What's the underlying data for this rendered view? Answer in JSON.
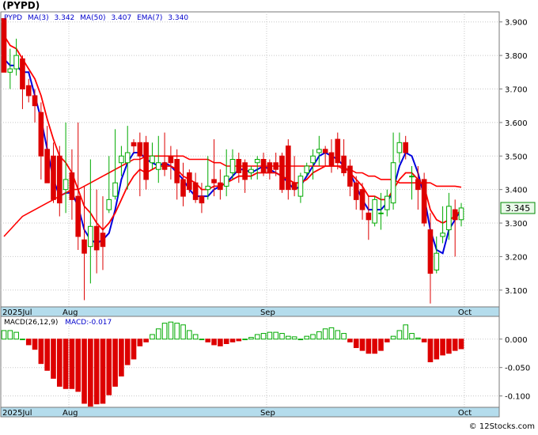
{
  "ticker_label": "(PYPD)",
  "legend": {
    "symbol": "PYPD",
    "ma3_label": "MA(3)",
    "ma3_value": "3.342",
    "ma50_label": "MA(50)",
    "ma50_value": "3.407",
    "ema7_label": "EMA(7)",
    "ema7_value": "3.340"
  },
  "last_price_badge": "3.345",
  "macd_legend": {
    "label": "MACD(26,12,9)",
    "value_label": "MACD:-0.017"
  },
  "watermark": "© 12Stocks.com",
  "colors": {
    "up_candle": "#00aa00",
    "down_candle": "#dd0000",
    "ma_red": "#ff0000",
    "ma_blue": "#0000dd",
    "month_band": "#b4dcec",
    "grid": "#c8c8c8",
    "badge_bg": "#e9fae9",
    "badge_border": "#008800"
  },
  "chart_data": [
    {
      "type": "candlestick",
      "title": "(PYPD)",
      "ylim": [
        3.05,
        3.93
      ],
      "y_ticks": [
        "3.100",
        "3.200",
        "3.300",
        "3.400",
        "3.500",
        "3.600",
        "3.700",
        "3.800",
        "3.900"
      ],
      "x_month_labels": [
        "2025Jul",
        "Aug",
        "Sep",
        "Oct"
      ],
      "x_month_label_index": [
        0,
        11,
        43,
        75
      ],
      "grid": true,
      "ohlc": [
        [
          3.91,
          3.91,
          3.75,
          3.75
        ],
        [
          3.75,
          3.82,
          3.7,
          3.76
        ],
        [
          3.76,
          3.85,
          3.74,
          3.8
        ],
        [
          3.79,
          3.8,
          3.64,
          3.7
        ],
        [
          3.71,
          3.73,
          3.66,
          3.68
        ],
        [
          3.68,
          3.7,
          3.6,
          3.65
        ],
        [
          3.63,
          3.66,
          3.43,
          3.5
        ],
        [
          3.52,
          3.59,
          3.42,
          3.42
        ],
        [
          3.5,
          3.54,
          3.36,
          3.37
        ],
        [
          3.5,
          3.53,
          3.32,
          3.36
        ],
        [
          3.4,
          3.6,
          3.33,
          3.43
        ],
        [
          3.45,
          3.52,
          3.31,
          3.37
        ],
        [
          3.38,
          3.6,
          3.22,
          3.26
        ],
        [
          3.25,
          3.41,
          3.07,
          3.21
        ],
        [
          3.23,
          3.49,
          3.12,
          3.29
        ],
        [
          3.29,
          3.4,
          3.15,
          3.22
        ],
        [
          3.27,
          3.38,
          3.16,
          3.23
        ],
        [
          3.34,
          3.5,
          3.33,
          3.37
        ],
        [
          3.38,
          3.58,
          3.37,
          3.42
        ],
        [
          3.48,
          3.53,
          3.44,
          3.5
        ],
        [
          3.48,
          3.59,
          3.4,
          3.51
        ],
        [
          3.54,
          3.55,
          3.51,
          3.53
        ],
        [
          3.54,
          3.57,
          3.38,
          3.5
        ],
        [
          3.54,
          3.56,
          3.4,
          3.43
        ],
        [
          3.48,
          3.54,
          3.46,
          3.5
        ],
        [
          3.46,
          3.56,
          3.42,
          3.48
        ],
        [
          3.48,
          3.57,
          3.44,
          3.46
        ],
        [
          3.5,
          3.53,
          3.43,
          3.48
        ],
        [
          3.49,
          3.52,
          3.37,
          3.42
        ],
        [
          3.43,
          3.48,
          3.35,
          3.38
        ],
        [
          3.45,
          3.46,
          3.39,
          3.4
        ],
        [
          3.42,
          3.45,
          3.36,
          3.37
        ],
        [
          3.38,
          3.42,
          3.33,
          3.36
        ],
        [
          3.4,
          3.5,
          3.37,
          3.41
        ],
        [
          3.43,
          3.55,
          3.38,
          3.42
        ],
        [
          3.42,
          3.46,
          3.37,
          3.4
        ],
        [
          3.41,
          3.52,
          3.38,
          3.44
        ],
        [
          3.45,
          3.52,
          3.43,
          3.49
        ],
        [
          3.49,
          3.51,
          3.42,
          3.45
        ],
        [
          3.48,
          3.49,
          3.39,
          3.43
        ],
        [
          3.45,
          3.47,
          3.43,
          3.46
        ],
        [
          3.48,
          3.5,
          3.43,
          3.49
        ],
        [
          3.49,
          3.51,
          3.44,
          3.45
        ],
        [
          3.48,
          3.49,
          3.43,
          3.45
        ],
        [
          3.48,
          3.51,
          3.44,
          3.46
        ],
        [
          3.5,
          3.51,
          3.39,
          3.4
        ],
        [
          3.53,
          3.55,
          3.37,
          3.4
        ],
        [
          3.42,
          3.5,
          3.38,
          3.4
        ],
        [
          3.38,
          3.45,
          3.36,
          3.44
        ],
        [
          3.45,
          3.48,
          3.44,
          3.47
        ],
        [
          3.48,
          3.52,
          3.43,
          3.5
        ],
        [
          3.51,
          3.56,
          3.47,
          3.52
        ],
        [
          3.52,
          3.53,
          3.47,
          3.51
        ],
        [
          3.51,
          3.55,
          3.45,
          3.47
        ],
        [
          3.55,
          3.57,
          3.46,
          3.48
        ],
        [
          3.5,
          3.55,
          3.44,
          3.45
        ],
        [
          3.47,
          3.49,
          3.38,
          3.41
        ],
        [
          3.42,
          3.44,
          3.34,
          3.37
        ],
        [
          3.4,
          3.42,
          3.31,
          3.34
        ],
        [
          3.33,
          3.38,
          3.25,
          3.31
        ],
        [
          3.3,
          3.38,
          3.29,
          3.37
        ],
        [
          3.33,
          3.39,
          3.28,
          3.33
        ],
        [
          3.34,
          3.4,
          3.32,
          3.38
        ],
        [
          3.36,
          3.57,
          3.34,
          3.48
        ],
        [
          3.51,
          3.57,
          3.48,
          3.54
        ],
        [
          3.54,
          3.56,
          3.49,
          3.51
        ],
        [
          3.44,
          3.47,
          3.37,
          3.44
        ],
        [
          3.43,
          3.47,
          3.34,
          3.4
        ],
        [
          3.43,
          3.45,
          3.29,
          3.3
        ],
        [
          3.28,
          3.33,
          3.06,
          3.15
        ],
        [
          3.16,
          3.26,
          3.15,
          3.21
        ],
        [
          3.26,
          3.35,
          3.24,
          3.27
        ],
        [
          3.28,
          3.39,
          3.25,
          3.35
        ],
        [
          3.34,
          3.37,
          3.2,
          3.31
        ],
        [
          3.31,
          3.36,
          3.29,
          3.345
        ]
      ],
      "series": [
        {
          "name": "MA(3)",
          "values": [
            3.79,
            3.77,
            3.77,
            3.75,
            3.75,
            3.68,
            3.61,
            3.52,
            3.43,
            3.38,
            3.39,
            3.39,
            3.35,
            3.28,
            3.25,
            3.24,
            3.25,
            3.27,
            3.34,
            3.43,
            3.48,
            3.51,
            3.51,
            3.49,
            3.48,
            3.47,
            3.48,
            3.47,
            3.45,
            3.43,
            3.4,
            3.38,
            3.38,
            3.38,
            3.4,
            3.41,
            3.42,
            3.44,
            3.46,
            3.46,
            3.45,
            3.46,
            3.47,
            3.46,
            3.45,
            3.44,
            3.42,
            3.4,
            3.41,
            3.44,
            3.47,
            3.5,
            3.51,
            3.5,
            3.49,
            3.47,
            3.45,
            3.41,
            3.37,
            3.34,
            3.34,
            3.34,
            3.36,
            3.4,
            3.47,
            3.51,
            3.5,
            3.45,
            3.38,
            3.28,
            3.22,
            3.21,
            3.28,
            3.31,
            3.342
          ]
        },
        {
          "name": "MA(50)",
          "values": [
            3.26,
            3.28,
            3.3,
            3.32,
            3.33,
            3.34,
            3.35,
            3.36,
            3.37,
            3.38,
            3.39,
            3.4,
            3.4,
            3.41,
            3.42,
            3.43,
            3.44,
            3.45,
            3.46,
            3.47,
            3.48,
            3.49,
            3.49,
            3.5,
            3.5,
            3.5,
            3.5,
            3.5,
            3.5,
            3.5,
            3.49,
            3.49,
            3.49,
            3.49,
            3.48,
            3.48,
            3.47,
            3.47,
            3.47,
            3.47,
            3.47,
            3.47,
            3.47,
            3.47,
            3.47,
            3.47,
            3.47,
            3.47,
            3.47,
            3.47,
            3.47,
            3.47,
            3.47,
            3.47,
            3.47,
            3.46,
            3.46,
            3.45,
            3.45,
            3.44,
            3.44,
            3.43,
            3.43,
            3.43,
            3.42,
            3.42,
            3.42,
            3.42,
            3.42,
            3.42,
            3.41,
            3.41,
            3.41,
            3.41,
            3.407
          ]
        },
        {
          "name": "EMA(7)",
          "values": [
            3.86,
            3.83,
            3.82,
            3.79,
            3.76,
            3.73,
            3.68,
            3.61,
            3.55,
            3.5,
            3.48,
            3.45,
            3.4,
            3.35,
            3.33,
            3.3,
            3.28,
            3.3,
            3.33,
            3.37,
            3.41,
            3.44,
            3.46,
            3.45,
            3.46,
            3.47,
            3.47,
            3.47,
            3.46,
            3.44,
            3.43,
            3.42,
            3.4,
            3.4,
            3.41,
            3.41,
            3.42,
            3.43,
            3.44,
            3.44,
            3.44,
            3.45,
            3.45,
            3.45,
            3.45,
            3.44,
            3.43,
            3.42,
            3.42,
            3.43,
            3.45,
            3.46,
            3.47,
            3.47,
            3.47,
            3.47,
            3.45,
            3.43,
            3.41,
            3.38,
            3.38,
            3.37,
            3.37,
            3.4,
            3.43,
            3.45,
            3.45,
            3.43,
            3.41,
            3.34,
            3.31,
            3.3,
            3.31,
            3.32,
            3.34
          ]
        }
      ]
    },
    {
      "type": "bar",
      "title": "MACD(26,12,9)",
      "ylim": [
        -0.12,
        0.04
      ],
      "y_ticks": [
        "0.000",
        "-0.050",
        "-0.100"
      ],
      "x_month_labels": [
        "2025Jul",
        "Aug",
        "Sep",
        "Oct"
      ],
      "series": [
        {
          "name": "MACD",
          "values": [
            0.015,
            0.015,
            0.012,
            0.0,
            -0.01,
            -0.018,
            -0.043,
            -0.055,
            -0.069,
            -0.083,
            -0.087,
            -0.087,
            -0.092,
            -0.113,
            -0.118,
            -0.114,
            -0.113,
            -0.098,
            -0.083,
            -0.065,
            -0.045,
            -0.035,
            -0.012,
            -0.005,
            0.008,
            0.018,
            0.028,
            0.03,
            0.028,
            0.025,
            0.015,
            0.008,
            0.0,
            -0.005,
            -0.01,
            -0.012,
            -0.008,
            -0.005,
            -0.003,
            0.0,
            0.003,
            0.008,
            0.01,
            0.012,
            0.012,
            0.01,
            0.005,
            0.004,
            0.0,
            0.005,
            0.008,
            0.013,
            0.018,
            0.02,
            0.015,
            0.01,
            -0.005,
            -0.015,
            -0.02,
            -0.025,
            -0.025,
            -0.02,
            -0.005,
            0.005,
            0.015,
            0.025,
            0.01,
            0.002,
            -0.005,
            -0.04,
            -0.035,
            -0.028,
            -0.025,
            -0.02,
            -0.017
          ]
        }
      ]
    }
  ]
}
